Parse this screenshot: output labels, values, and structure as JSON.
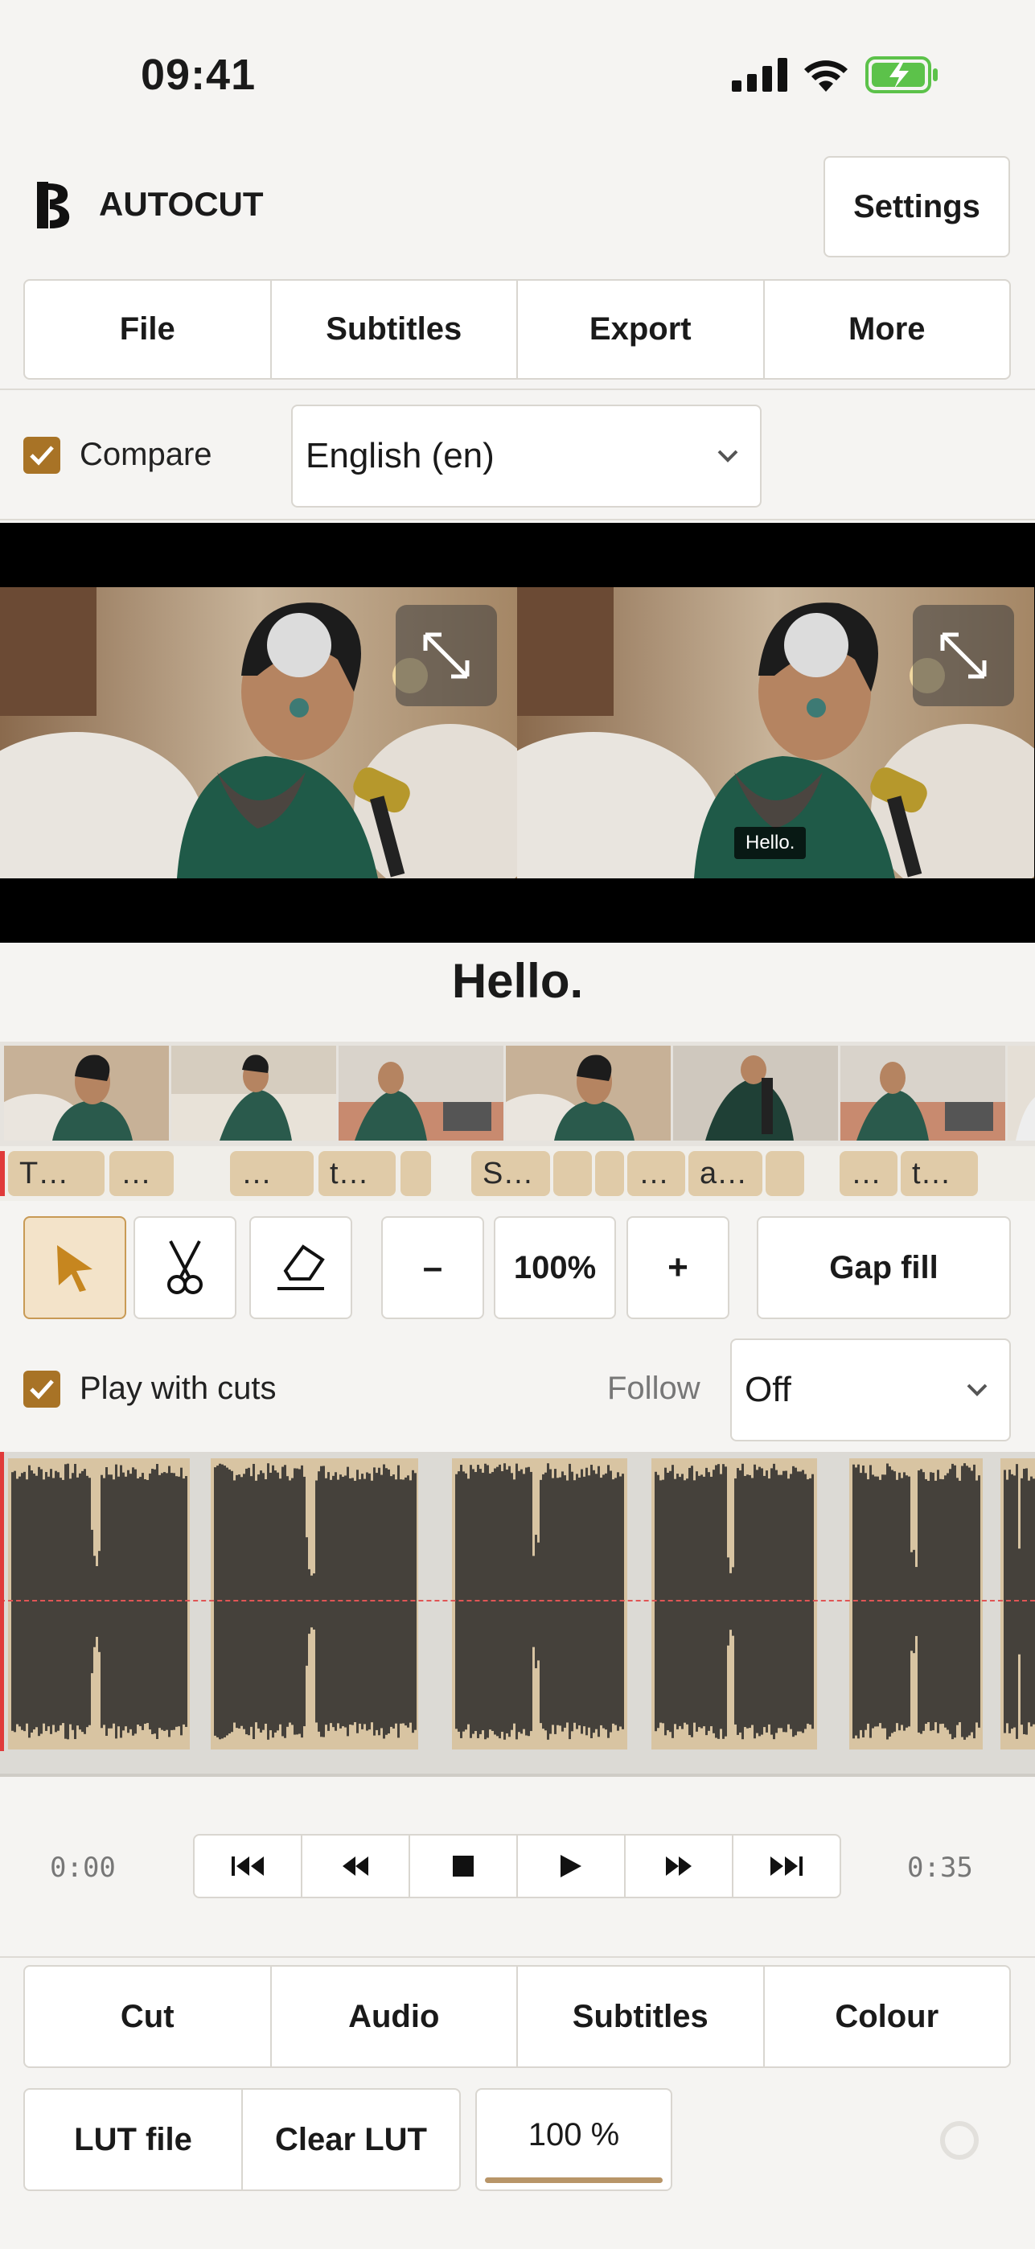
{
  "status_bar": {
    "time": "09:41"
  },
  "header": {
    "brand": "AUTOCUT",
    "settings_label": "Settings"
  },
  "main_menu": [
    {
      "label": "File"
    },
    {
      "label": "Subtitles"
    },
    {
      "label": "Export"
    },
    {
      "label": "More"
    }
  ],
  "compare": {
    "label": "Compare",
    "checked": true,
    "language": "English (en)"
  },
  "preview": {
    "burned_subtitle": "Hello."
  },
  "current_subtitle": "Hello.",
  "segments": [
    "T…",
    "…",
    "…",
    "t…",
    "S…",
    "…",
    "a…",
    "…",
    "t…"
  ],
  "tools": {
    "zoom_out": "–",
    "zoom": "100%",
    "zoom_in": "+",
    "gap_fill": "Gap fill"
  },
  "playback": {
    "play_with_cuts_label": "Play with cuts",
    "play_with_cuts": true,
    "follow_label": "Follow",
    "follow_value": "Off"
  },
  "transport": {
    "start_time": "0:00",
    "end_time": "0:35"
  },
  "bottom_tabs": [
    {
      "label": "Cut"
    },
    {
      "label": "Audio"
    },
    {
      "label": "Subtitles"
    },
    {
      "label": "Colour"
    }
  ],
  "lut": {
    "lut_file": "LUT file",
    "clear_lut": "Clear LUT",
    "intensity": "100 %"
  },
  "colors": {
    "accent": "#a87326",
    "clip": "#d8c4a2",
    "waveform": "#45413b",
    "playhead": "#e03a3a"
  }
}
